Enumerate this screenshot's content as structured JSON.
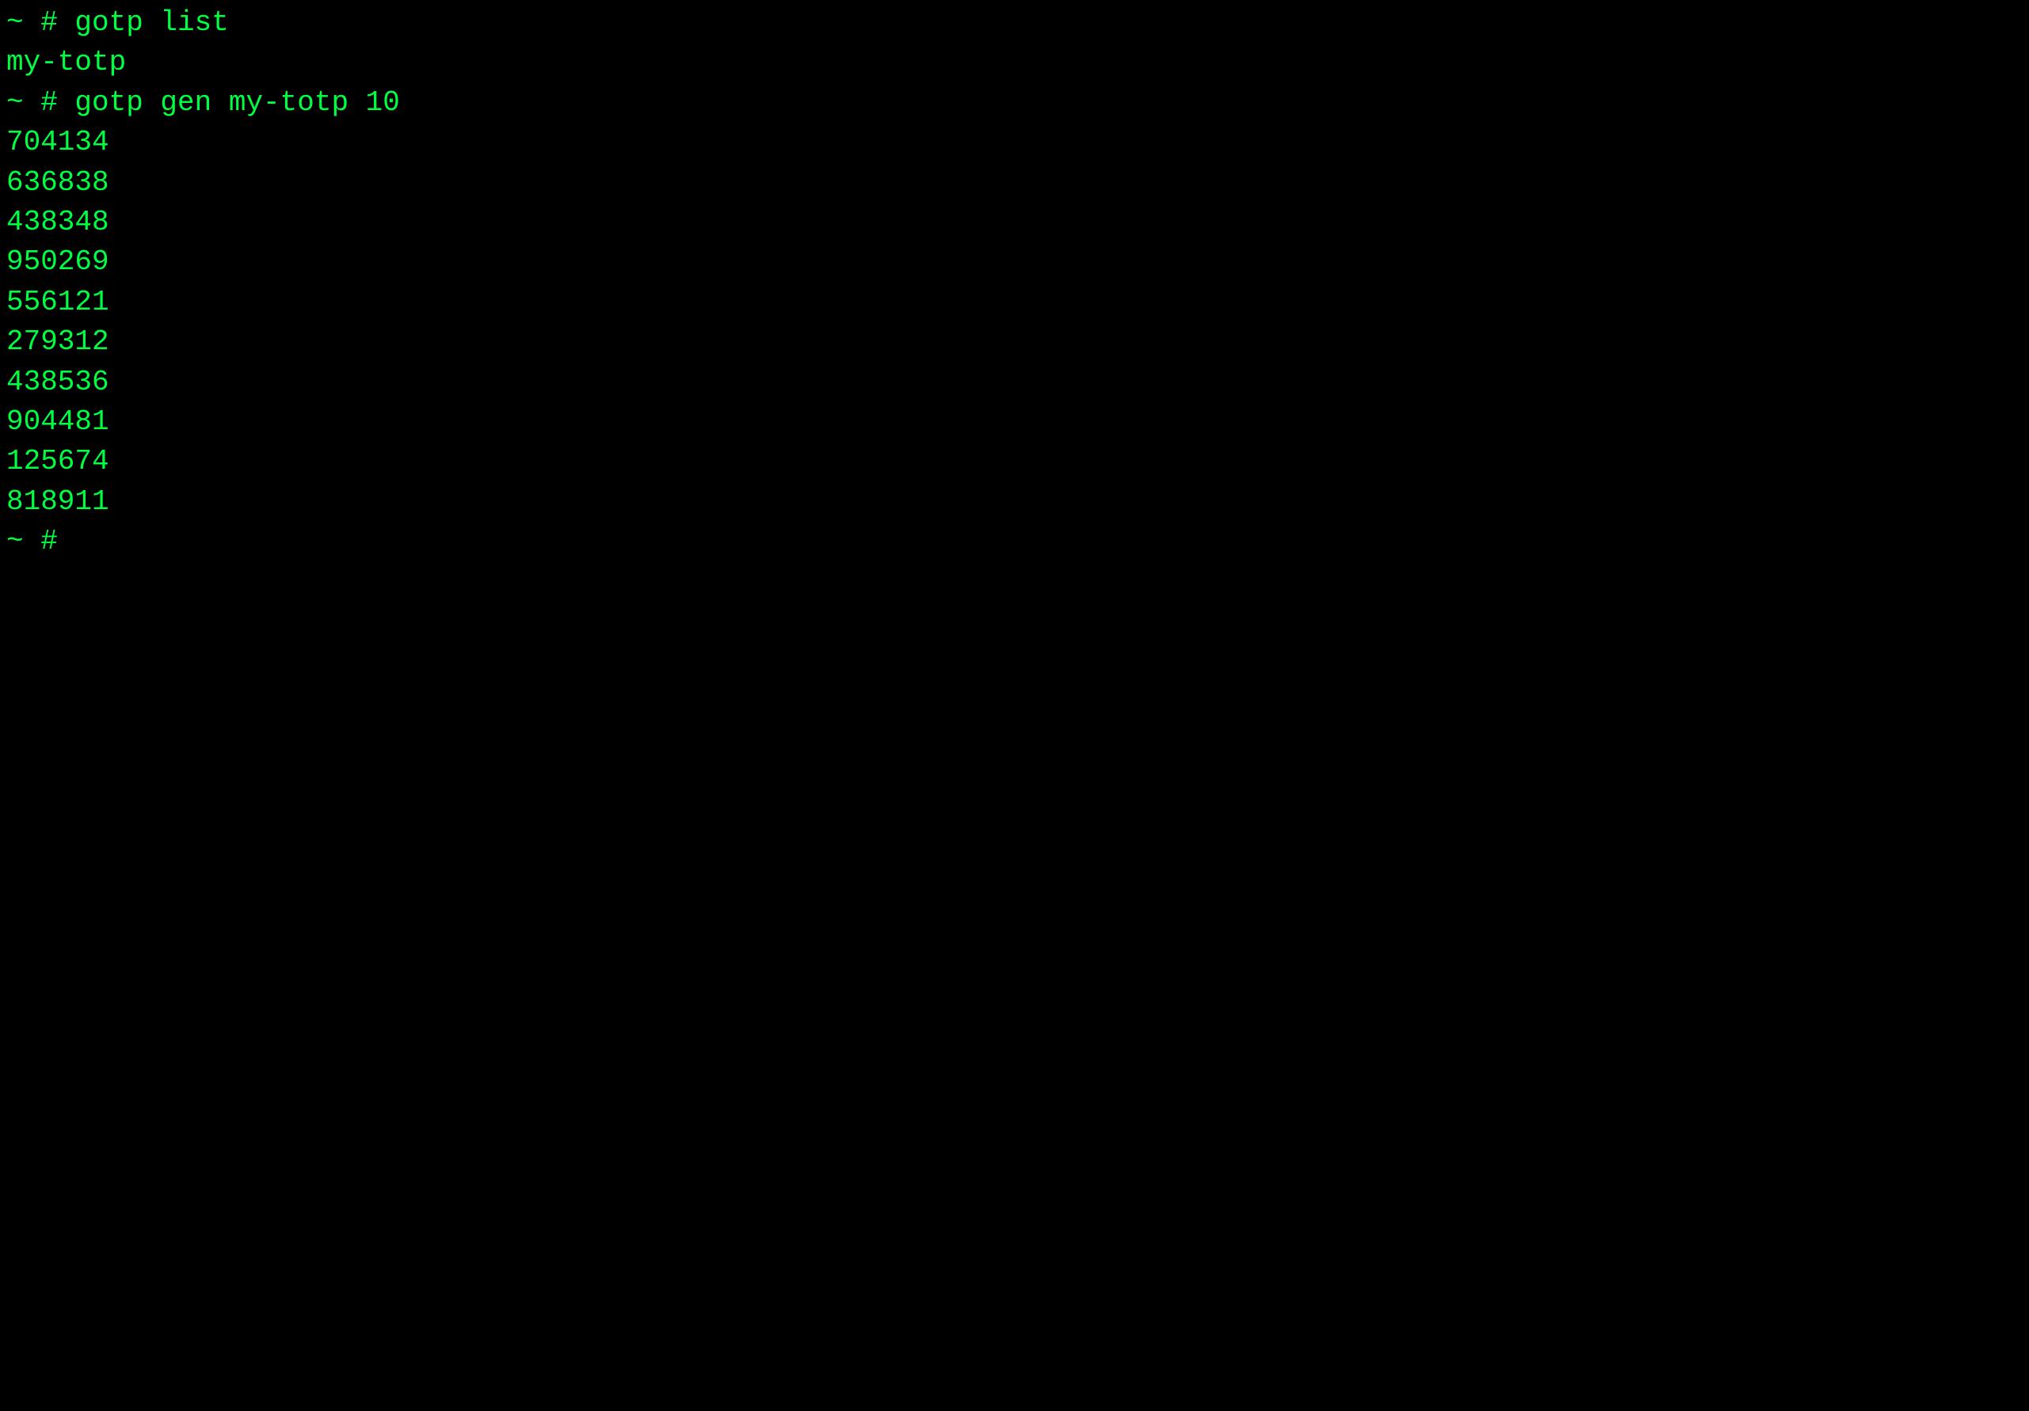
{
  "terminal": {
    "lines": [
      {
        "type": "prompt",
        "text": "~ # gotp list"
      },
      {
        "type": "output",
        "text": "my-totp"
      },
      {
        "type": "prompt",
        "text": "~ # gotp gen my-totp 10"
      },
      {
        "type": "output",
        "text": "704134"
      },
      {
        "type": "output",
        "text": "636838"
      },
      {
        "type": "output",
        "text": "438348"
      },
      {
        "type": "output",
        "text": "950269"
      },
      {
        "type": "output",
        "text": "556121"
      },
      {
        "type": "output",
        "text": "279312"
      },
      {
        "type": "output",
        "text": "438536"
      },
      {
        "type": "output",
        "text": "904481"
      },
      {
        "type": "output",
        "text": "125674"
      },
      {
        "type": "output",
        "text": "818911"
      },
      {
        "type": "prompt",
        "text": "~ #"
      }
    ]
  }
}
